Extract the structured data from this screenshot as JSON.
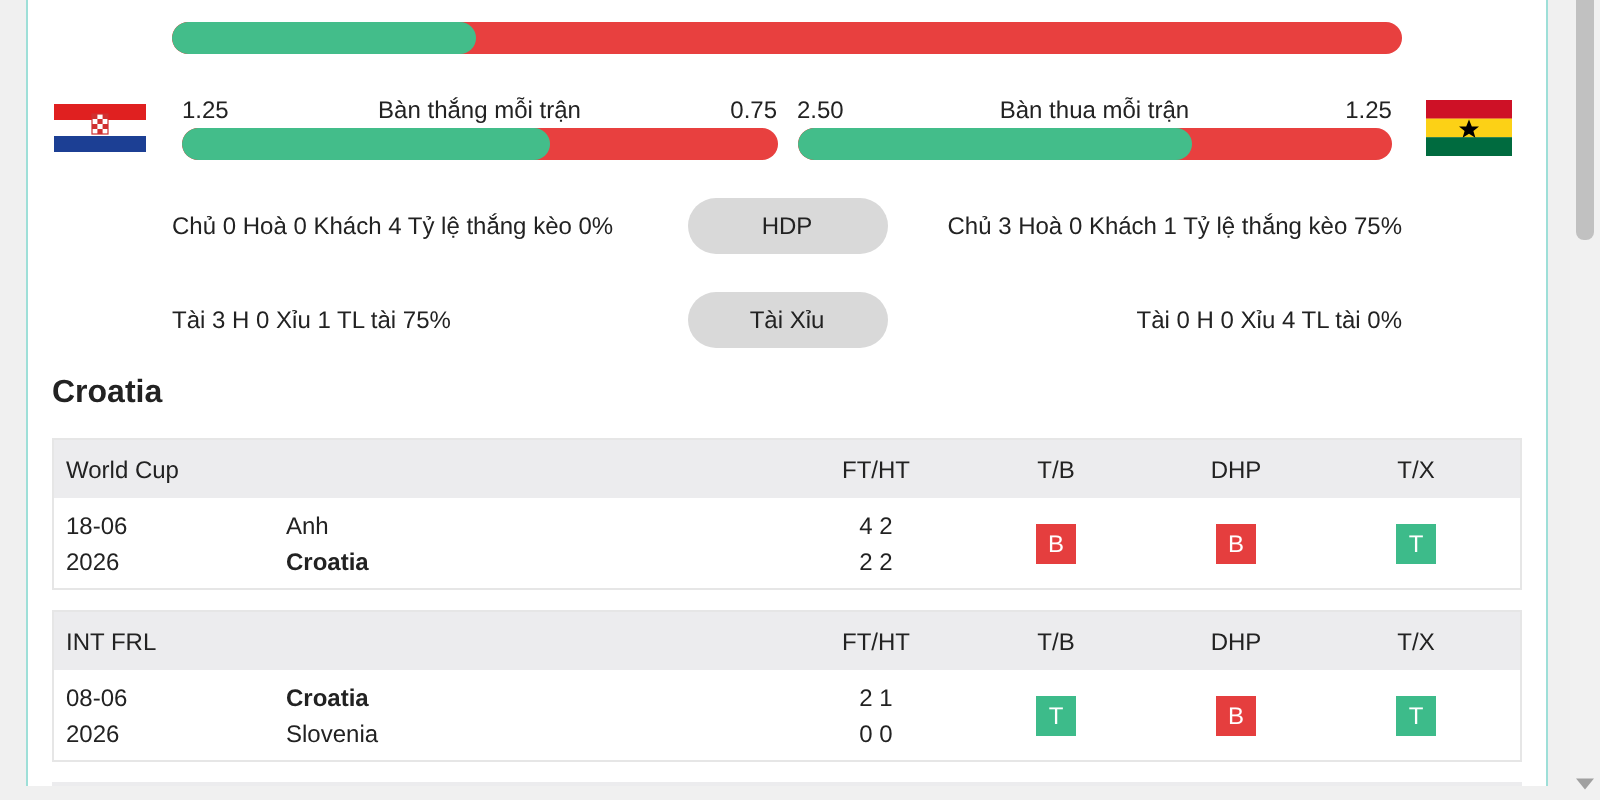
{
  "top_bar": {
    "level": 0.247
  },
  "comparisons": [
    {
      "title": "Bàn thắng mỗi trận",
      "home": "1.25",
      "away": "0.75",
      "level": 0.62
    },
    {
      "title": "Bàn thua mỗi trận",
      "home": "2.50",
      "away": "1.25",
      "level": 0.665
    }
  ],
  "stat_rows": [
    {
      "home": "Chủ 0 Hoà 0 Khách 4 Tỷ lệ thắng kèo 0%",
      "button": "HDP",
      "away": "Chủ 3 Hoà 0 Khách 1 Tỷ lệ thắng kèo 75%"
    },
    {
      "home": "Tài 3 H 0 Xỉu 1 TL tài 75%",
      "button": "Tài Xỉu",
      "away": "Tài 0 H 0 Xỉu 4 TL tài 0%"
    }
  ],
  "team_section": {
    "title": "Croatia",
    "tables": [
      {
        "competition": "World Cup",
        "columns": [
          "FT/HT",
          "T/B",
          "DHP",
          "T/X"
        ],
        "matches": [
          {
            "date": "18-06",
            "year": "2026",
            "teams": [
              {
                "name": "Anh",
                "bold": false,
                "score": "4 2"
              },
              {
                "name": "Croatia",
                "bold": true,
                "score": "2 2"
              }
            ],
            "results": [
              {
                "label": "B",
                "color": "#e53e3e"
              },
              {
                "label": "B",
                "color": "#e53e3e"
              },
              {
                "label": "T",
                "color": "#3dbb8a"
              }
            ]
          }
        ]
      },
      {
        "competition": "INT FRL",
        "columns": [
          "FT/HT",
          "T/B",
          "DHP",
          "T/X"
        ],
        "matches": [
          {
            "date": "08-06",
            "year": "2026",
            "teams": [
              {
                "name": "Croatia",
                "bold": true,
                "score": "2 1"
              },
              {
                "name": "Slovenia",
                "bold": false,
                "score": "0 0"
              }
            ],
            "results": [
              {
                "label": "T",
                "color": "#3dbb8a"
              },
              {
                "label": "B",
                "color": "#e53e3e"
              },
              {
                "label": "T",
                "color": "#3dbb8a"
              }
            ]
          }
        ]
      }
    ]
  }
}
